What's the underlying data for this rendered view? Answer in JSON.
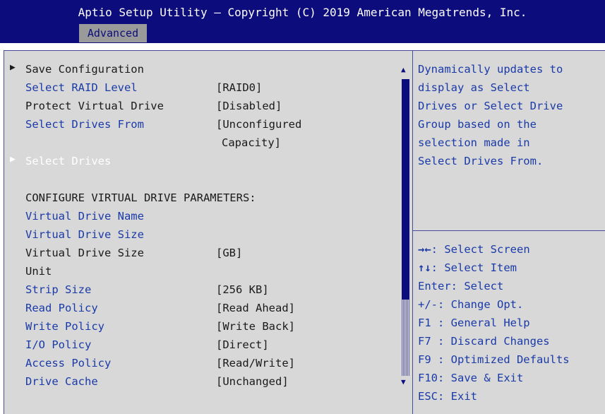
{
  "header": {
    "title": "Aptio Setup Utility – Copyright (C) 2019 American Megatrends, Inc.",
    "active_tab": "Advanced"
  },
  "menu": {
    "save_configuration": "Save Configuration",
    "select_raid_level": {
      "label": "Select RAID Level",
      "value": "[RAID0]"
    },
    "protect_virtual_drive": {
      "label": "Protect Virtual Drive",
      "value": "[Disabled]"
    },
    "select_drives_from": {
      "label": "Select Drives From",
      "value_line1": "[Unconfigured",
      "value_line2": "Capacity]"
    },
    "select_drives": "Select Drives",
    "section_heading": "CONFIGURE VIRTUAL DRIVE PARAMETERS:",
    "virtual_drive_name": {
      "label": "Virtual Drive Name"
    },
    "virtual_drive_size": {
      "label": "Virtual Drive Size"
    },
    "virtual_drive_size_unit": {
      "label_line1": "Virtual Drive Size",
      "label_line2": "Unit",
      "value": "[GB]"
    },
    "strip_size": {
      "label": "Strip Size",
      "value": "[256 KB]"
    },
    "read_policy": {
      "label": "Read Policy",
      "value": "[Read Ahead]"
    },
    "write_policy": {
      "label": "Write Policy",
      "value": "[Write Back]"
    },
    "io_policy": {
      "label": "I/O Policy",
      "value": "[Direct]"
    },
    "access_policy": {
      "label": "Access Policy",
      "value": "[Read/Write]"
    },
    "drive_cache": {
      "label": "Drive Cache",
      "value": "[Unchanged]"
    }
  },
  "help": {
    "lines": [
      "Dynamically updates to",
      "display as Select",
      "Drives or Select Drive",
      "Group based on the",
      "selection made in",
      "Select Drives From."
    ]
  },
  "keys": {
    "select_screen_glyph": "→←",
    "select_screen": ": Select Screen",
    "select_item_glyph": "↑↓",
    "select_item": ": Select Item",
    "enter": "Enter: Select",
    "change": "+/-: Change Opt.",
    "f1": "F1 : General Help",
    "f7": "F7 : Discard Changes",
    "f9": "F9 : Optimized Defaults",
    "f10": "F10: Save & Exit",
    "esc": "ESC: Exit"
  },
  "colors": {
    "header_bg": "#0c0c7c",
    "panel_bg": "#d8d8d8",
    "tab_bg": "#9a9a9a",
    "link_text": "#1a3aa8",
    "highlight_text": "#ffffff"
  },
  "icons": {
    "submenu": "triangle-right-icon",
    "scroll_up": "triangle-up-icon",
    "scroll_down": "triangle-down-icon"
  }
}
